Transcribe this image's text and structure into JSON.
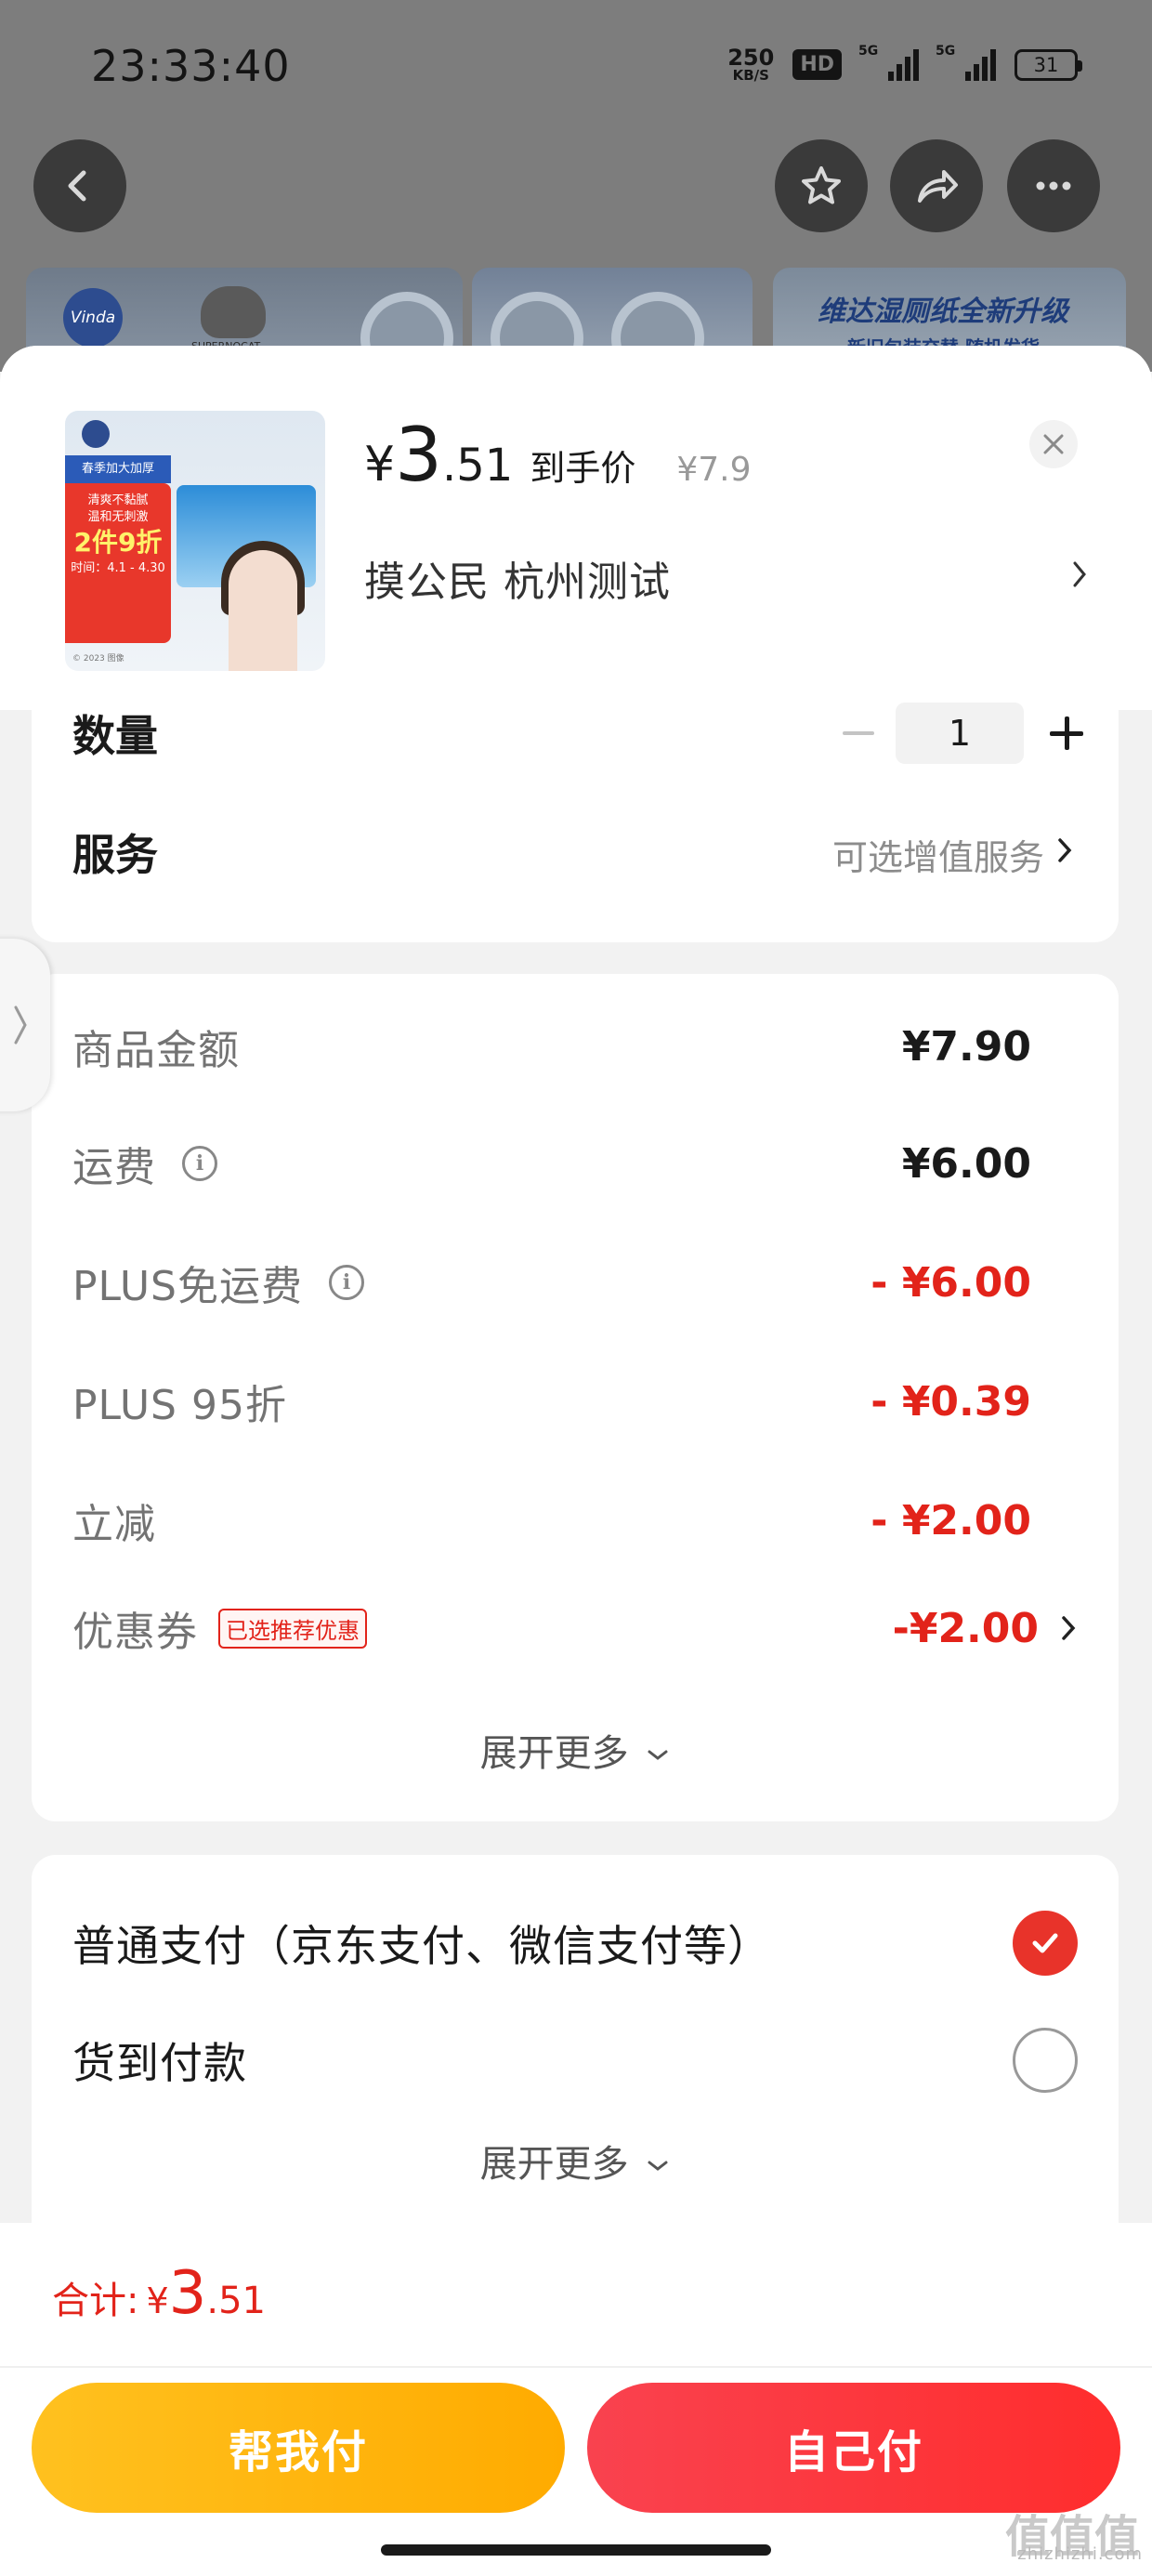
{
  "status_bar": {
    "time": "23:33:40",
    "net_speed": "250",
    "net_unit": "KB/S",
    "hd": "HD",
    "sim1": "5G",
    "sim2": "5G",
    "battery": "31"
  },
  "top_buttons": [
    "back-icon",
    "star-icon",
    "share-icon",
    "more-icon"
  ],
  "banner": {
    "logo_text": "Vinda",
    "brand_tag": "SUPERNOCAT",
    "headline": "维达湿厕纸全新升级",
    "subline": "新旧包装交替 随机发货"
  },
  "product": {
    "thumb": {
      "tag": "春季加大加厚",
      "promo_lines": [
        "清爽不黏腻",
        "温和无刺激"
      ],
      "promo_big": "2件9折",
      "date": "时间：4.1 - 4.30",
      "copyright": "© 2023 图像"
    },
    "price_symbol": "¥",
    "price_int": "3",
    "price_dec": ".51",
    "price_label": "到手价",
    "original_price": "¥7.9",
    "address": "摸公民  杭州测试",
    "close_icon": "close-icon"
  },
  "quantity": {
    "label": "数量",
    "value": "1"
  },
  "service": {
    "label": "服务",
    "value": "可选增值服务"
  },
  "fees": [
    {
      "label": "商品金额",
      "value": "¥7.90",
      "red": false,
      "info": false
    },
    {
      "label": "运费",
      "value": "¥6.00",
      "red": false,
      "info": true
    },
    {
      "label": "PLUS免运费",
      "value": "- ¥6.00",
      "red": true,
      "info": true
    },
    {
      "label": "PLUS 95折",
      "value": "- ¥0.39",
      "red": true,
      "info": false
    },
    {
      "label": "立减",
      "value": "- ¥2.00",
      "red": true,
      "info": false
    },
    {
      "label": "优惠券",
      "value": "-¥2.00",
      "red": true,
      "info": false,
      "tag": "已选推荐优惠"
    }
  ],
  "expand_more": "展开更多",
  "payment": {
    "options": [
      {
        "label": "普通支付（京东支付、微信支付等）",
        "selected": true
      },
      {
        "label": "货到付款",
        "selected": false
      }
    ],
    "expand_more": "展开更多"
  },
  "footer": {
    "total_label": "合计:",
    "total_symbol": "¥",
    "total_int": "3",
    "total_dec": ".51",
    "help_pay": "帮我付",
    "self_pay": "自己付",
    "watermark": "zhizhizhi.com",
    "watermark_big": "值值值"
  },
  "colors": {
    "accent_red": "#e2231a",
    "help_yellow": "#ffb300",
    "self_red": "#f9424f"
  }
}
